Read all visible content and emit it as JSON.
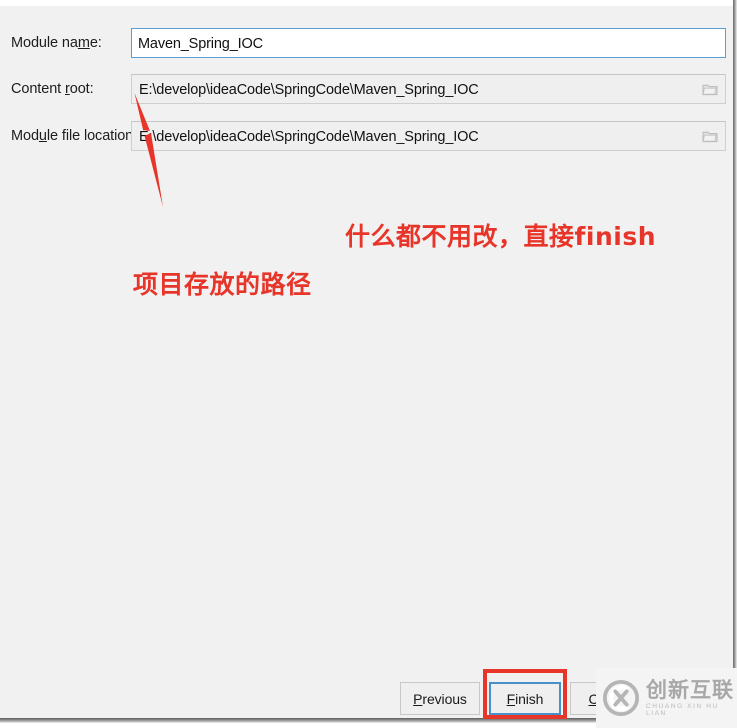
{
  "dialog": {
    "fields": [
      {
        "label_before": "Module na",
        "label_mnemonic": "m",
        "label_after": "e:",
        "value": "Maven_Spring_IOC",
        "focused": true,
        "has_browse": false,
        "browse_icon": "folder-icon"
      },
      {
        "label_before": "Content ",
        "label_mnemonic": "r",
        "label_after": "oot:",
        "value": "E:\\develop\\ideaCode\\SpringCode\\Maven_Spring_IOC",
        "focused": false,
        "has_browse": true,
        "browse_icon": "folder-icon"
      },
      {
        "label_before": "Mod",
        "label_mnemonic": "u",
        "label_after": "le file location:",
        "value": "E:\\develop\\ideaCode\\SpringCode\\Maven_Spring_IOC",
        "focused": false,
        "has_browse": true,
        "browse_icon": "folder-icon"
      }
    ],
    "buttons": {
      "previous": {
        "before": "",
        "mnemonic": "P",
        "after": "revious"
      },
      "finish": {
        "before": "",
        "mnemonic": "F",
        "after": "inish"
      },
      "cancel": {
        "before": "",
        "mnemonic": "C",
        "after": "ancel"
      }
    }
  },
  "annotations": {
    "color": "#e8352a",
    "top_note": "什么都不用改，直接finish",
    "bottom_note": "项目存放的路径",
    "arrow_name": "red-arrow-icon",
    "highlight_name": "finish-button-highlight"
  },
  "watermark": {
    "main": "创新互联",
    "sub": "CHUANG XIN HU LIAN",
    "logo_name": "cx-logo-icon"
  }
}
